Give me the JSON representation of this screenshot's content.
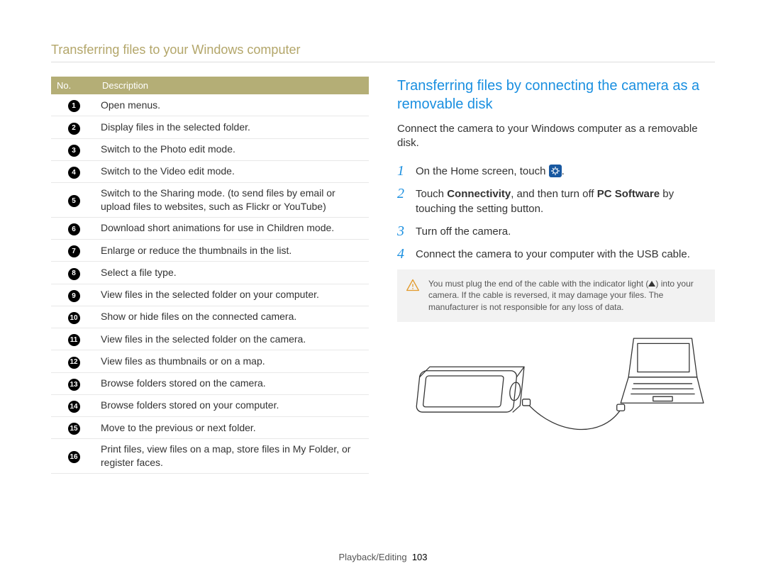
{
  "breadcrumb": "Transferring files to your Windows computer",
  "table": {
    "headers": {
      "num": "No.",
      "desc": "Description"
    },
    "rows": [
      "Open menus.",
      "Display files in the selected folder.",
      "Switch to the Photo edit mode.",
      "Switch to the Video edit mode.",
      "Switch to the Sharing mode. (to send files by email or upload files to websites, such as Flickr or YouTube)",
      "Download short animations for use in Children mode.",
      "Enlarge or reduce the thumbnails in the list.",
      "Select a file type.",
      "View files in the selected folder on your computer.",
      "Show or hide files on the connected camera.",
      "View files in the selected folder on the camera.",
      "View files as thumbnails or on a map.",
      "Browse folders stored on the camera.",
      "Browse folders stored on your computer.",
      "Move to the previous or next folder.",
      "Print files, view files on a map, store files in My Folder, or register faces."
    ]
  },
  "section_title": "Transferring files by connecting the camera as a removable disk",
  "intro": "Connect the camera to your Windows computer as a removable disk.",
  "steps": {
    "s1_pre": "On the Home screen, touch ",
    "s1_post": ".",
    "s2_pre": "Touch ",
    "s2_b1": "Connectivity",
    "s2_mid": ", and then turn off ",
    "s2_b2": "PC Software",
    "s2_post": " by touching the setting button.",
    "s3": "Turn off the camera.",
    "s4": "Connect the camera to your computer with the USB cable."
  },
  "note": {
    "l1_pre": "You must plug the end of the cable with the indicator light (",
    "l1_post": ") into your camera. If the cable is reversed, it may damage your files. The manufacturer is not responsible for any loss of data."
  },
  "footer": {
    "section": "Playback/Editing",
    "page": "103"
  }
}
